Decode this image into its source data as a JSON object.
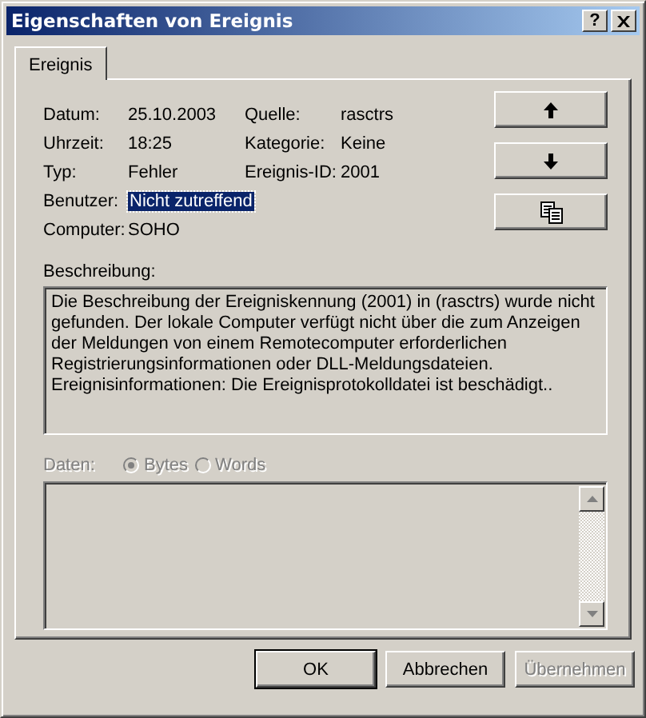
{
  "window": {
    "title": "Eigenschaften von Ereignis",
    "help": "?"
  },
  "tabs": [
    {
      "label": "Ereignis",
      "selected": true
    }
  ],
  "details": {
    "left": [
      {
        "label": "Datum:",
        "value": "25.10.2003",
        "selected": false
      },
      {
        "label": "Uhrzeit:",
        "value": "18:25",
        "selected": false
      },
      {
        "label": "Typ:",
        "value": "Fehler",
        "selected": false
      },
      {
        "label": "Benutzer:",
        "value": "Nicht zutreffend",
        "selected": true
      },
      {
        "label": "Computer:",
        "value": "SOHO",
        "selected": false
      }
    ],
    "right": [
      {
        "label": "Quelle:",
        "value": "rasctrs",
        "selected": false
      },
      {
        "label": "Kategorie:",
        "value": "Keine",
        "selected": false
      },
      {
        "label": "Ereignis-ID:",
        "value": "2001",
        "selected": false
      }
    ]
  },
  "side_buttons": [
    {
      "kind": "up"
    },
    {
      "kind": "down"
    },
    {
      "kind": "copy"
    }
  ],
  "description": {
    "label": "Beschreibung:",
    "text": "Die Beschreibung der Ereigniskennung (2001) in (rasctrs) wurde nicht gefunden. Der lokale Computer verfügt nicht über die zum Anzeigen der Meldungen von einem Remotecomputer erforderlichen Registrierungsinformationen oder DLL-Meldungsdateien. Ereignisinformationen: Die Ereignisprotokolldatei ist beschädigt.."
  },
  "data": {
    "label": "Daten:",
    "disabled": true,
    "options": [
      {
        "label": "Bytes",
        "selected": true
      },
      {
        "label": "Words",
        "selected": false
      }
    ]
  },
  "buttons": [
    {
      "label": "OK",
      "default": true,
      "disabled": false
    },
    {
      "label": "Abbrechen",
      "default": false,
      "disabled": false
    },
    {
      "label": "Übernehmen",
      "default": false,
      "disabled": true
    }
  ]
}
